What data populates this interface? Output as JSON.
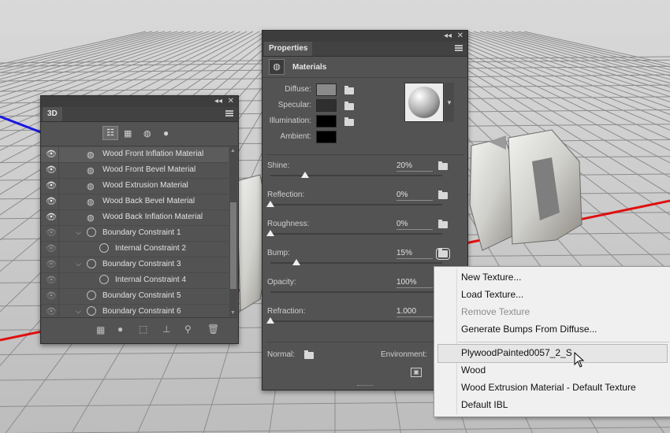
{
  "panel3d": {
    "tab": "3D",
    "collapse": "◂◂",
    "close": "✕",
    "filter_icons": [
      "scene-filter-icon",
      "mesh-filter-icon",
      "material-filter-icon",
      "light-filter-icon"
    ],
    "rows": [
      {
        "label": "Wood Front Inflation Material",
        "kind": "material",
        "visible": true,
        "selected": true
      },
      {
        "label": "Wood Front Bevel Material",
        "kind": "material",
        "visible": true
      },
      {
        "label": "Wood Extrusion Material",
        "kind": "material",
        "visible": true
      },
      {
        "label": "Wood Back Bevel Material",
        "kind": "material",
        "visible": true
      },
      {
        "label": "Wood Back Inflation Material",
        "kind": "material",
        "visible": true
      },
      {
        "label": "Boundary Constraint 1",
        "kind": "constraint",
        "visible": false
      },
      {
        "label": "Internal Constraint 2",
        "kind": "internal",
        "visible": false
      },
      {
        "label": "Boundary Constraint 3",
        "kind": "constraint",
        "visible": false
      },
      {
        "label": "Internal Constraint 4",
        "kind": "internal",
        "visible": false
      },
      {
        "label": "Boundary Constraint 5",
        "kind": "constraint-plain",
        "visible": false
      },
      {
        "label": "Boundary Constraint 6",
        "kind": "constraint",
        "visible": false
      }
    ]
  },
  "properties": {
    "tab": "Properties",
    "collapse": "◂◂",
    "close": "✕",
    "section": "Materials",
    "swatches": [
      {
        "label": "Diffuse:",
        "color": "#8a8a8a"
      },
      {
        "label": "Specular:",
        "color": "#2f2f2f"
      },
      {
        "label": "Illumination:",
        "color": "#000000"
      },
      {
        "label": "Ambient:",
        "color": "#000000"
      }
    ],
    "sliders": [
      {
        "label": "Shine:",
        "value": "20%",
        "level": 0.2
      },
      {
        "label": "Reflection:",
        "value": "0%",
        "level": 0
      },
      {
        "label": "Roughness:",
        "value": "0%",
        "level": 0
      },
      {
        "label": "Bump:",
        "value": "15%",
        "level": 0.15
      },
      {
        "label": "Opacity:",
        "value": "100%",
        "level": 1
      },
      {
        "label": "Refraction:",
        "value": "1.000",
        "level": 0
      }
    ],
    "normal_label": "Normal:",
    "environment_label": "Environment:"
  },
  "context_menu": {
    "items": [
      {
        "label": "New Texture...",
        "enabled": true
      },
      {
        "label": "Load Texture...",
        "enabled": true
      },
      {
        "label": "Remove Texture",
        "enabled": false
      },
      {
        "label": "Generate Bumps From Diffuse...",
        "enabled": true
      }
    ],
    "texture_items": [
      {
        "label": "PlywoodPainted0057_2_S",
        "highlighted": true
      },
      {
        "label": "Wood"
      },
      {
        "label": "Wood Extrusion Material - Default Texture"
      },
      {
        "label": "Default IBL"
      }
    ]
  },
  "colors": {
    "axis_red": "#e01010",
    "axis_blue": "#1818e0",
    "panel_bg": "#535353",
    "menu_bg": "#f0f0f0"
  }
}
